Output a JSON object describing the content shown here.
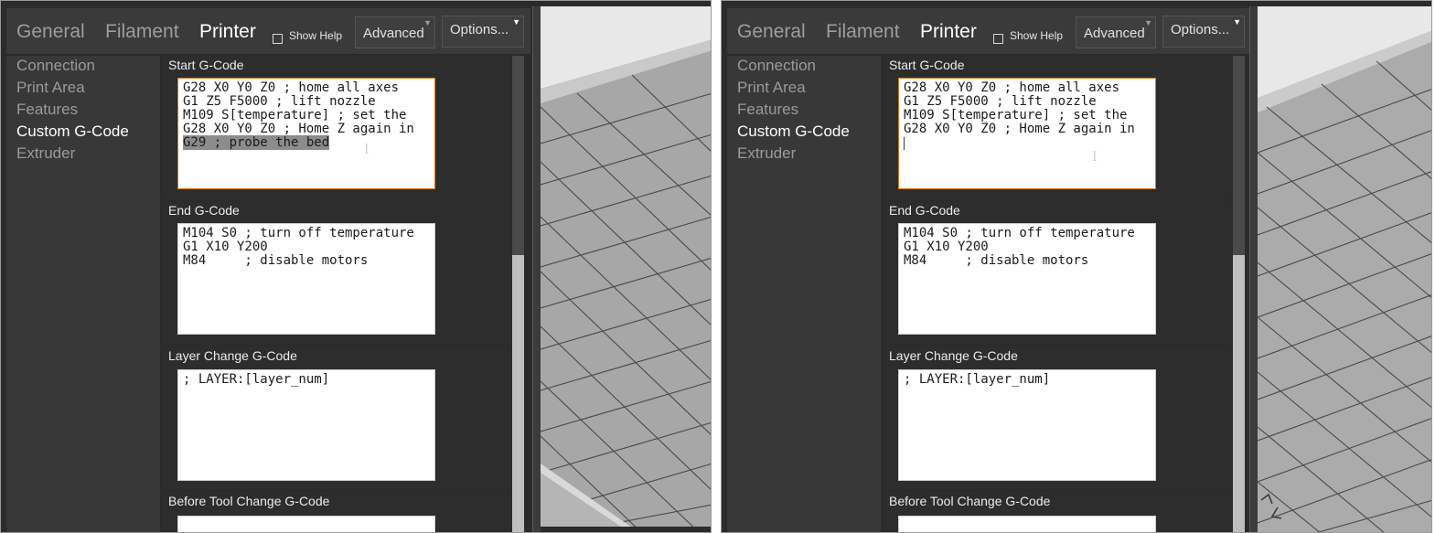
{
  "screens": [
    {
      "tabs": {
        "general": "General",
        "filament": "Filament",
        "printer": "Printer"
      },
      "show_help": {
        "label": "Show Help",
        "checked": false
      },
      "mode_button": "Advanced",
      "options_button": "Options...",
      "sidebar": {
        "items": [
          {
            "label": "Connection",
            "active": false
          },
          {
            "label": "Print Area",
            "active": false
          },
          {
            "label": "Features",
            "active": false
          },
          {
            "label": "Custom G-Code",
            "active": true
          },
          {
            "label": "Extruder",
            "active": false
          }
        ]
      },
      "sections": {
        "start": {
          "label": "Start G-Code",
          "lines": [
            "G28 X0 Y0 Z0 ; home all axes",
            "G1 Z5 F5000 ; lift nozzle",
            "M109 S[temperature] ; set the",
            "G28 X0 Y0 Z0 ; Home Z again in",
            "G29 ; probe the bed"
          ],
          "selected_line": "G29 ; probe the bed"
        },
        "end": {
          "label": "End G-Code",
          "lines": [
            "M104 S0 ; turn off temperature",
            "G1 X10 Y200",
            "M84     ; disable motors"
          ]
        },
        "layer": {
          "label": "Layer Change G-Code",
          "lines": [
            "; LAYER:[layer_num]"
          ]
        },
        "before_tool": {
          "label": "Before Tool Change G-Code"
        }
      }
    },
    {
      "tabs": {
        "general": "General",
        "filament": "Filament",
        "printer": "Printer"
      },
      "show_help": {
        "label": "Show Help",
        "checked": false
      },
      "mode_button": "Advanced",
      "options_button": "Options...",
      "sidebar": {
        "items": [
          {
            "label": "Connection",
            "active": false
          },
          {
            "label": "Print Area",
            "active": false
          },
          {
            "label": "Features",
            "active": false
          },
          {
            "label": "Custom G-Code",
            "active": true
          },
          {
            "label": "Extruder",
            "active": false
          }
        ]
      },
      "sections": {
        "start": {
          "label": "Start G-Code",
          "lines": [
            "G28 X0 Y0 Z0 ; home all axes",
            "G1 Z5 F5000 ; lift nozzle",
            "M109 S[temperature] ; set the",
            "G28 X0 Y0 Z0 ; Home Z again in"
          ]
        },
        "end": {
          "label": "End G-Code",
          "lines": [
            "M104 S0 ; turn off temperature",
            "G1 X10 Y200",
            "M84     ; disable motors"
          ]
        },
        "layer": {
          "label": "Layer Change G-Code",
          "lines": [
            "; LAYER:[layer_num]"
          ]
        },
        "before_tool": {
          "label": "Before Tool Change G-Code"
        }
      }
    }
  ],
  "colors": {
    "panel_bg": "#2b2b2b",
    "tab_inactive": "#9d9d9d",
    "tab_active": "#ffffff",
    "focus_border": "#d97b1d",
    "selection": "#8c8c8c",
    "viewport_bg": "#e8e8e8",
    "grid_line": "#4a4a4a"
  }
}
